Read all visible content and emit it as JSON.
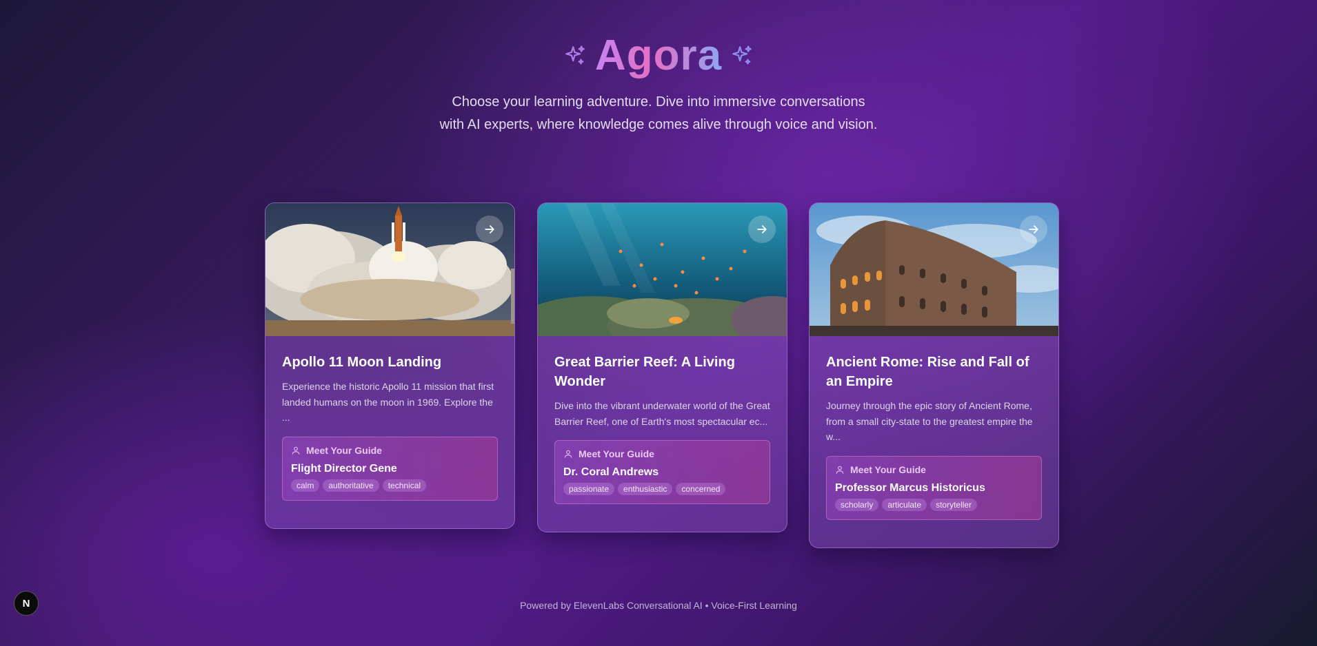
{
  "header": {
    "title": "Agora",
    "subtitle": "Choose your learning adventure. Dive into immersive conversations with AI experts, where knowledge comes alive through voice and vision."
  },
  "cards": [
    {
      "title": "Apollo 11 Moon Landing",
      "description": "Experience the historic Apollo 11 mission that first landed humans on the moon in 1969. Explore the ...",
      "image": "rocket-launch-image",
      "guide_label": "Meet Your Guide",
      "guide_name": "Flight Director Gene",
      "tags": [
        "calm",
        "authoritative",
        "technical"
      ]
    },
    {
      "title": "Great Barrier Reef: A Living Wonder",
      "description": "Dive into the vibrant underwater world of the Great Barrier Reef, one of Earth's most spectacular ec...",
      "image": "coral-reef-image",
      "guide_label": "Meet Your Guide",
      "guide_name": "Dr. Coral Andrews",
      "tags": [
        "passionate",
        "enthusiastic",
        "concerned"
      ]
    },
    {
      "title": "Ancient Rome: Rise and Fall of an Empire",
      "description": "Journey through the epic story of Ancient Rome, from a small city-state to the greatest empire the w...",
      "image": "colosseum-image",
      "guide_label": "Meet Your Guide",
      "guide_name": "Professor Marcus Historicus",
      "tags": [
        "scholarly",
        "articulate",
        "storyteller"
      ]
    }
  ],
  "footer": {
    "text": "Powered by ElevenLabs Conversational AI • Voice-First Learning"
  },
  "dev_badge": {
    "label": "N"
  },
  "icons": {
    "sparkle": "sparkles-icon",
    "arrow": "arrow-right-icon",
    "user": "user-icon"
  },
  "colors": {
    "title_gradient": [
      "#c584f0",
      "#e56fc4",
      "#8ea6f2"
    ],
    "accent": "#e56fc4"
  }
}
